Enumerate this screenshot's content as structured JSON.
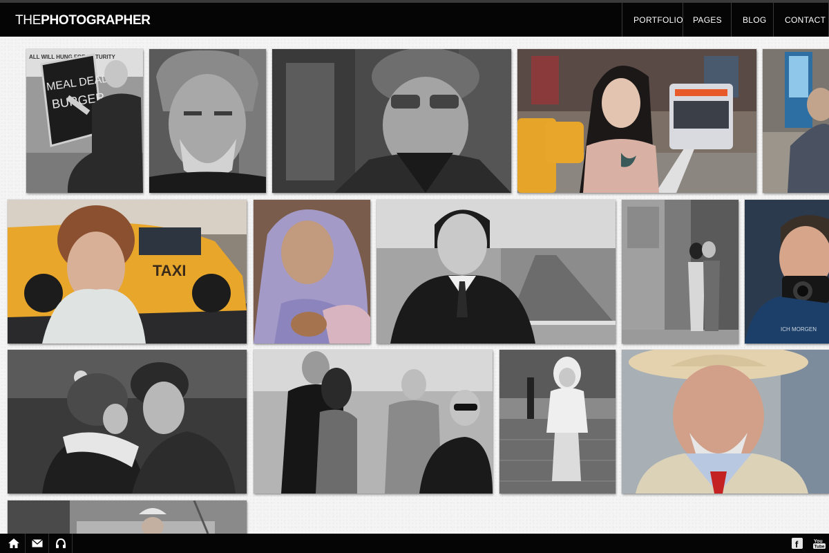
{
  "header": {
    "logo_prefix": "THE",
    "logo_main": "PHOTOGRAPHER",
    "nav": [
      "PORTFOLIO",
      "PAGES",
      "BLOG",
      "CONTACT"
    ]
  },
  "gallery": {
    "chalkboard_lines": [
      "MEAL DEAL",
      "BURGER"
    ],
    "sign_text": "ALL WILL HUNG FOR MATURITY",
    "taxi_text": "TAXI",
    "shirt_text": "ICH MORGEN"
  },
  "footer": {
    "left_icons": [
      "home-icon",
      "mail-icon",
      "headphones-icon"
    ],
    "right_icons": [
      "facebook-icon",
      "youtube-icon"
    ],
    "facebook_glyph": "f",
    "youtube_glyph": "You Tube"
  },
  "colors": {
    "header_bg": "#050505",
    "taxi_yellow": "#e8a62a",
    "page_bg": "#f4f4f4"
  }
}
